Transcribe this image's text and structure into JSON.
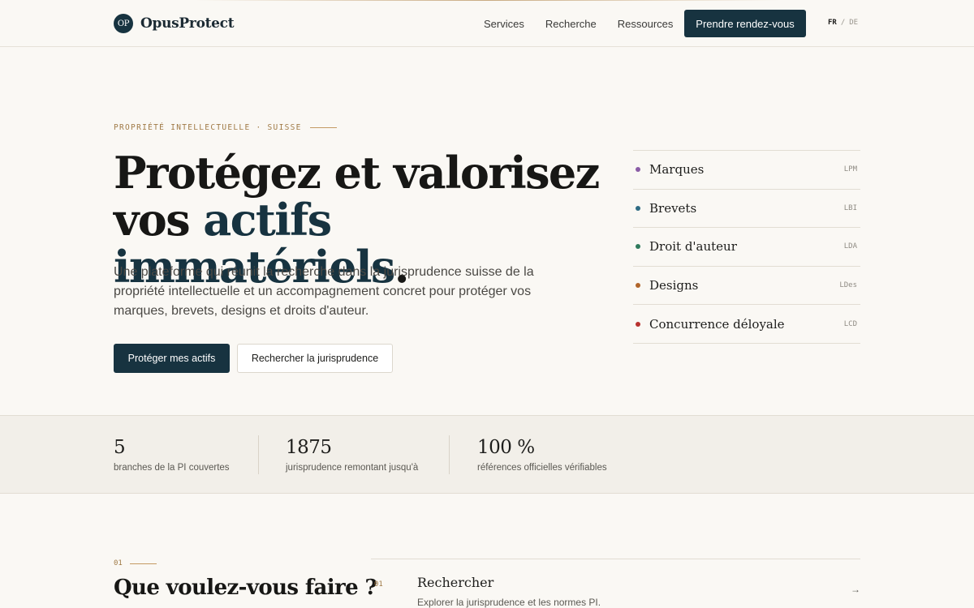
{
  "header": {
    "logo_mark": "OP",
    "logo_text": "OpusProtect",
    "nav": [
      "Services",
      "Recherche",
      "Ressources"
    ],
    "cta": "Prendre rendez-vous",
    "lang_active": "FR",
    "lang_sep": "/",
    "lang_other": "DE"
  },
  "hero": {
    "eyebrow": "PROPRIÉTÉ INTELLECTUELLE · SUISSE",
    "headline_line1": "Protégez et valorisez",
    "headline_line2_start": "vos ",
    "headline_accent": "actifs immatériels",
    "headline_end": ".",
    "lede": "Une plateforme qui réunit la recherche dans la jurisprudence suisse de la propriété intellectuelle et un accompagnement concret pour protéger vos marques, brevets, designs et droits d'auteur.",
    "primary_button": "Protéger mes actifs",
    "secondary_button": "Rechercher la jurisprudence"
  },
  "branches": [
    {
      "name": "Marques",
      "code": "LPM",
      "color": "#8a5ca6"
    },
    {
      "name": "Brevets",
      "code": "LBI",
      "color": "#2e6b83"
    },
    {
      "name": "Droit d'auteur",
      "code": "LDA",
      "color": "#2f7a5c"
    },
    {
      "name": "Designs",
      "code": "LDes",
      "color": "#b0652a"
    },
    {
      "name": "Concurrence déloyale",
      "code": "LCD",
      "color": "#b8322f"
    }
  ],
  "stats": [
    {
      "value": "5",
      "label": "branches de la PI couvertes"
    },
    {
      "value": "1875",
      "label": "jurisprudence remontant jusqu'à"
    },
    {
      "value": "100 %",
      "label": "références officielles vérifiables"
    }
  ],
  "section": {
    "number": "01",
    "title": "Que voulez-vous faire ?",
    "action": {
      "number": "01",
      "title": "Rechercher",
      "description": "Explorer la jurisprudence et les normes PI.",
      "arrow": "→"
    }
  },
  "colors": {
    "primary": "#173340",
    "accent_gold": "#a07a46",
    "background": "#faf8f4"
  }
}
